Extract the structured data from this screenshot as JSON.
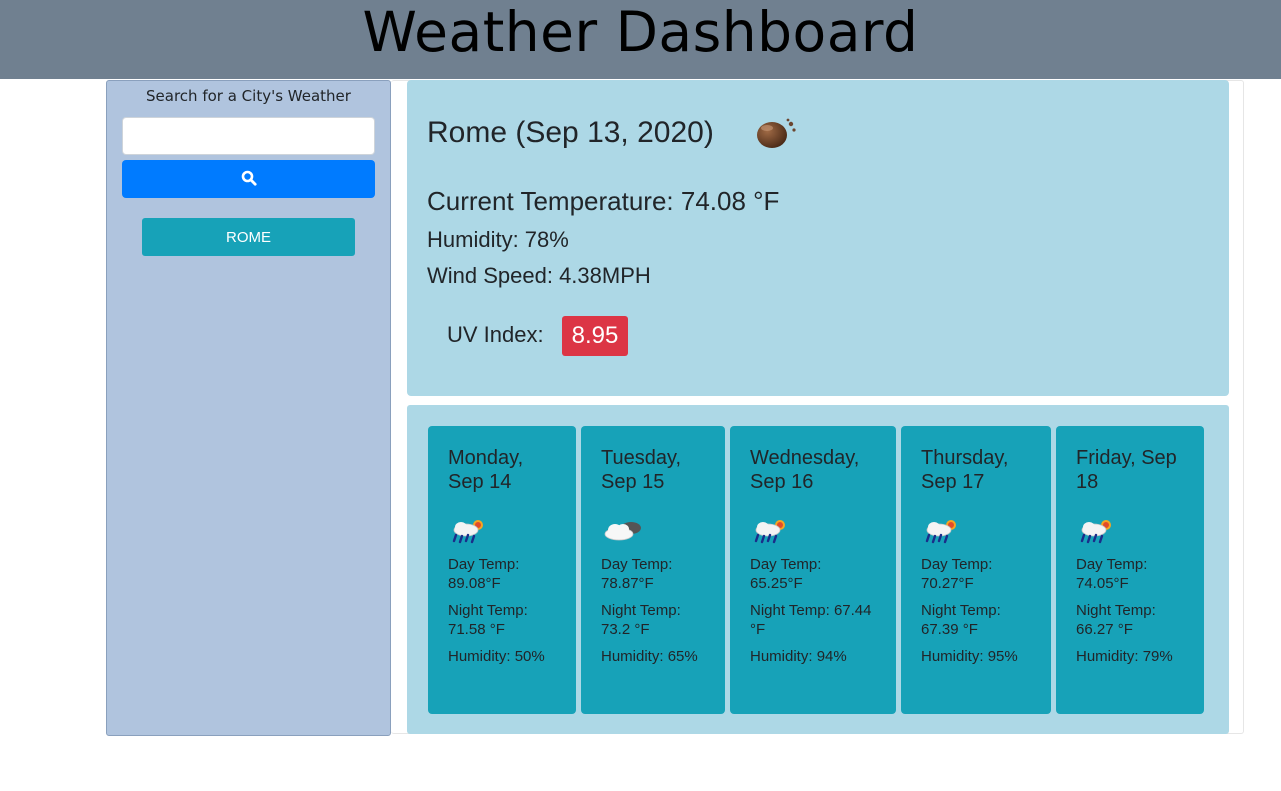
{
  "header": {
    "title": "Weather Dashboard"
  },
  "sidebar": {
    "search_label": "Search for a City's Weather",
    "search_value": "",
    "search_placeholder": "",
    "history": [
      "ROME"
    ]
  },
  "current": {
    "city_title": "Rome (Sep 13, 2020)",
    "icon": "rain-drop-icon",
    "temperature": "Current Temperature: 74.08 °F",
    "humidity": "Humidity: 78%",
    "wind": "Wind Speed: 4.38MPH",
    "uv_label": "UV Index:",
    "uv_value": "8.95",
    "uv_color": "#dc3545"
  },
  "forecast": [
    {
      "date": "Monday, Sep 14",
      "icon": "rain-sun-icon",
      "day_temp_label": "Day Temp:",
      "day_temp": "89.08°F",
      "night_temp_label": "Night Temp:",
      "night_temp": "71.58 °F",
      "humidity_label": "Humidity:",
      "humidity": "50%"
    },
    {
      "date": "Tuesday, Sep 15",
      "icon": "cloud-icon",
      "day_temp_label": "Day Temp:",
      "day_temp": "78.87°F",
      "night_temp_label": "Night Temp:",
      "night_temp": "73.2 °F",
      "humidity_label": "Humidity:",
      "humidity": "65%"
    },
    {
      "date": "Wednesday, Sep 16",
      "icon": "rain-sun-icon",
      "day_temp_label": "Day Temp:",
      "day_temp": "65.25°F",
      "night_temp_label": "Night Temp:",
      "night_temp": "67.44 °F",
      "humidity_label": "Humidity:",
      "humidity": "94%"
    },
    {
      "date": "Thursday, Sep 17",
      "icon": "rain-sun-icon",
      "day_temp_label": "Day Temp:",
      "day_temp": "70.27°F",
      "night_temp_label": "Night Temp:",
      "night_temp": "67.39 °F",
      "humidity_label": "Humidity:",
      "humidity": "95%"
    },
    {
      "date": "Friday, Sep 18",
      "icon": "rain-sun-icon",
      "day_temp_label": "Day Temp:",
      "day_temp": "74.05°F",
      "night_temp_label": "Night Temp:",
      "night_temp": "66.27 °F",
      "humidity_label": "Humidity:",
      "humidity": "79%"
    }
  ],
  "colors": {
    "header_bg": "#708090",
    "sidebar_bg": "#b0c4de",
    "search_button": "#007bff",
    "history_button": "#17a2b8",
    "panel_bg": "#add8e6",
    "forecast_card": "#17a2b8"
  }
}
